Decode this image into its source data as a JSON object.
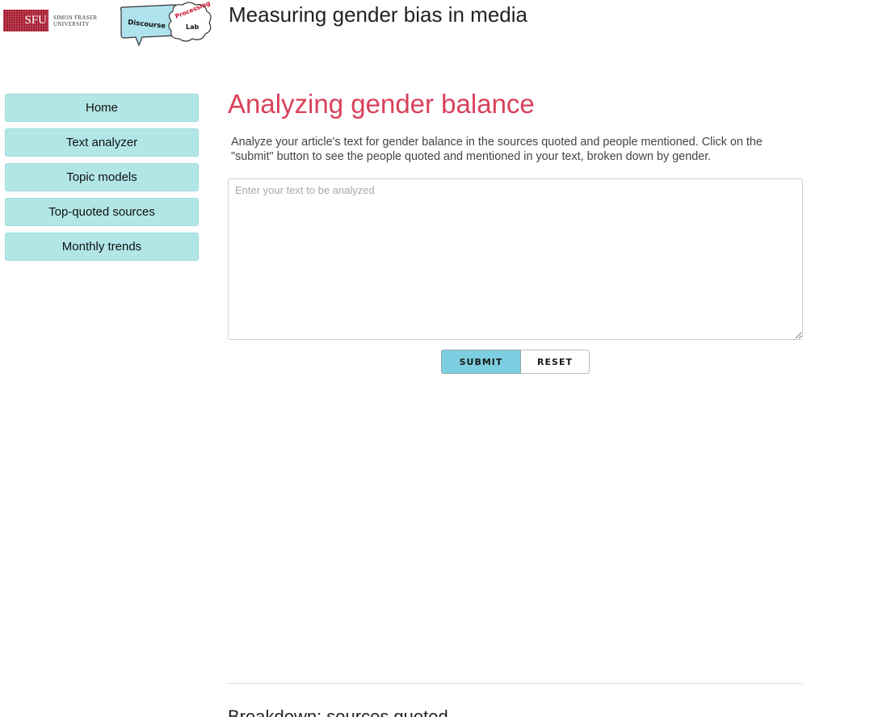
{
  "header": {
    "sfu_logo_letters": "SFU",
    "sfu_logo_name_line1": "SIMON FRASER",
    "sfu_logo_name_line2": "UNIVERSITY",
    "lab_logo_word1": "Discourse",
    "lab_logo_word2": "Processing",
    "lab_logo_word3": "Lab",
    "site_title": "Measuring gender bias in media"
  },
  "sidebar": {
    "items": [
      {
        "label": "Home"
      },
      {
        "label": "Text analyzer"
      },
      {
        "label": "Topic models"
      },
      {
        "label": "Top-quoted sources"
      },
      {
        "label": "Monthly trends"
      }
    ]
  },
  "main": {
    "heading": "Analyzing gender balance",
    "intro": "Analyze your article's text for gender balance in the sources quoted and people mentioned. Click on the \"submit\" button to see the people quoted and mentioned in your text, broken down by gender.",
    "textarea": {
      "placeholder": "Enter your text to be analyzed",
      "value": ""
    },
    "submit_label": "SUBMIT",
    "reset_label": "RESET",
    "section_heading": "Breakdown: sources quoted"
  },
  "colors": {
    "heading": "#d9415a",
    "nav_bg": "#b2e6e6",
    "submit_bg": "#7ccfe0",
    "sfu_red": "#a6192e"
  }
}
